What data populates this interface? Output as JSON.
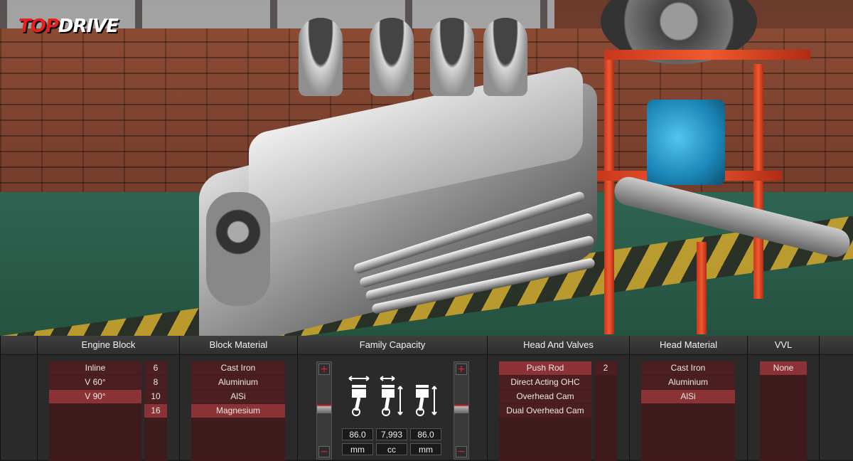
{
  "logo": {
    "part1": "TOP",
    "part2": "DRIVE"
  },
  "panel": {
    "engine_block": {
      "title": "Engine Block",
      "layouts": [
        "Inline",
        "V 60°",
        "V 90°",
        "",
        "",
        "",
        ""
      ],
      "selected_layout": "V 90°",
      "cylinders": [
        "6",
        "8",
        "10",
        "16",
        "",
        "",
        ""
      ],
      "selected_cylinders": "16"
    },
    "block_material": {
      "title": "Block Material",
      "options": [
        "Cast Iron",
        "Aluminium",
        "AlSi",
        "Magnesium",
        "",
        "",
        ""
      ],
      "selected": "Magnesium"
    },
    "family_capacity": {
      "title": "Family Capacity",
      "bore": "86.0",
      "displacement": "7,993",
      "stroke": "86.0",
      "units": [
        "mm",
        "cc",
        "mm"
      ],
      "plus_symbol": "+",
      "minus_symbol": "−"
    },
    "head_and_valves": {
      "title": "Head And Valves",
      "options": [
        "Push Rod",
        "Direct Acting OHC",
        "Overhead Cam",
        "Dual Overhead Cam",
        "",
        "",
        ""
      ],
      "selected": "Push Rod",
      "valves": [
        "2",
        "",
        "",
        "",
        "",
        "",
        ""
      ]
    },
    "head_material": {
      "title": "Head Material",
      "options": [
        "Cast Iron",
        "Aluminium",
        "AlSi",
        "",
        "",
        "",
        ""
      ],
      "selected": "AlSi"
    },
    "vvl": {
      "title": "VVL",
      "options": [
        "None",
        "",
        "",
        "",
        "",
        "",
        ""
      ],
      "selected": "None"
    }
  },
  "colors": {
    "accent": "#e8201c",
    "row": "#4b1e21",
    "row_selected": "#8a3235"
  }
}
